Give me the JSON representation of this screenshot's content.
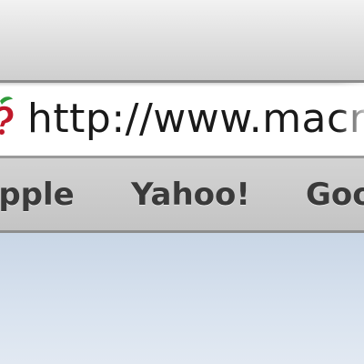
{
  "address_bar": {
    "url": "http://www.macr",
    "favicon": "macrumors-apple-icon"
  },
  "bookmarks": [
    {
      "label": "Apple"
    },
    {
      "label": "Yahoo!"
    },
    {
      "label": "Google"
    }
  ],
  "colors": {
    "toolbar": "#dedede",
    "bookmarks_bar": "#c8c8c8",
    "content_background": "#d3dfec"
  }
}
